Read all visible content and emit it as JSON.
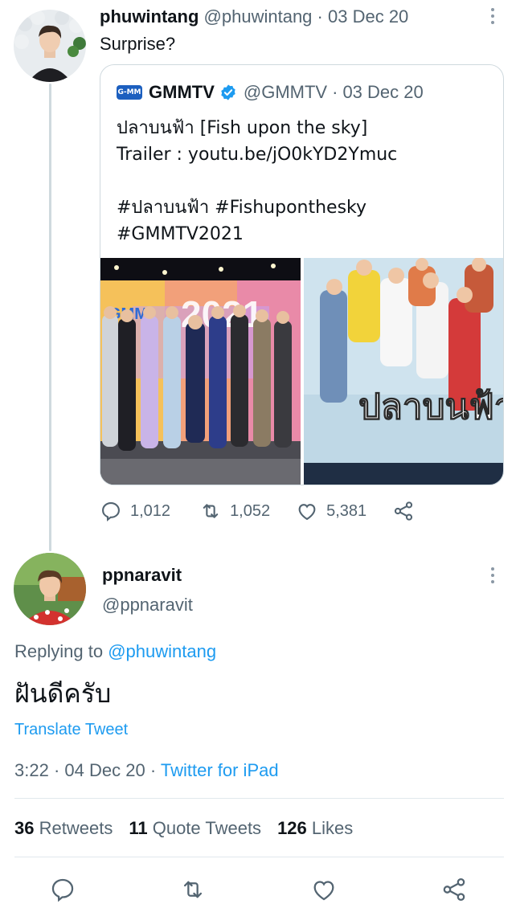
{
  "tweet1": {
    "display_name": "phuwintang",
    "handle": "@phuwintang",
    "separator": "·",
    "date": "03 Dec 20",
    "text": "Surprise?",
    "quote": {
      "logo_text": "G-MM",
      "display_name": "GMMTV",
      "handle": "@GMMTV",
      "separator": "·",
      "date": "03 Dec 20",
      "body": "ปลาบนฟ้า [Fish upon the sky]\nTrailer : youtu.be/jO0kYD2Ymuc\n\n#ปลาบนฟ้า #Fishuponthesky\n#GMMTV2021",
      "poster_title": "ปลาบนฟ้า",
      "banner_text": "2021"
    },
    "actions": {
      "replies": "1,012",
      "retweets": "1,052",
      "likes": "5,381"
    }
  },
  "tweet2": {
    "display_name": "ppnaravit",
    "handle": "@ppnaravit",
    "replying_prefix": "Replying to",
    "replying_to": "@phuwintang",
    "text": "ฝันดีครับ",
    "translate_label": "Translate Tweet",
    "time": "3:22",
    "date": "04 Dec 20",
    "separator": "·",
    "source": "Twitter for iPad",
    "stats": {
      "retweets_count": "36",
      "retweets_label": "Retweets",
      "quotes_count": "11",
      "quotes_label": "Quote Tweets",
      "likes_count": "126",
      "likes_label": "Likes"
    }
  },
  "icons": [
    "more-icon",
    "verified-icon",
    "reply-icon",
    "retweet-icon",
    "like-icon",
    "share-icon"
  ],
  "colors": {
    "link": "#1d9bf0",
    "secondary_text": "#536471",
    "border": "#cfd9de",
    "verified": "#1d9bf0"
  }
}
